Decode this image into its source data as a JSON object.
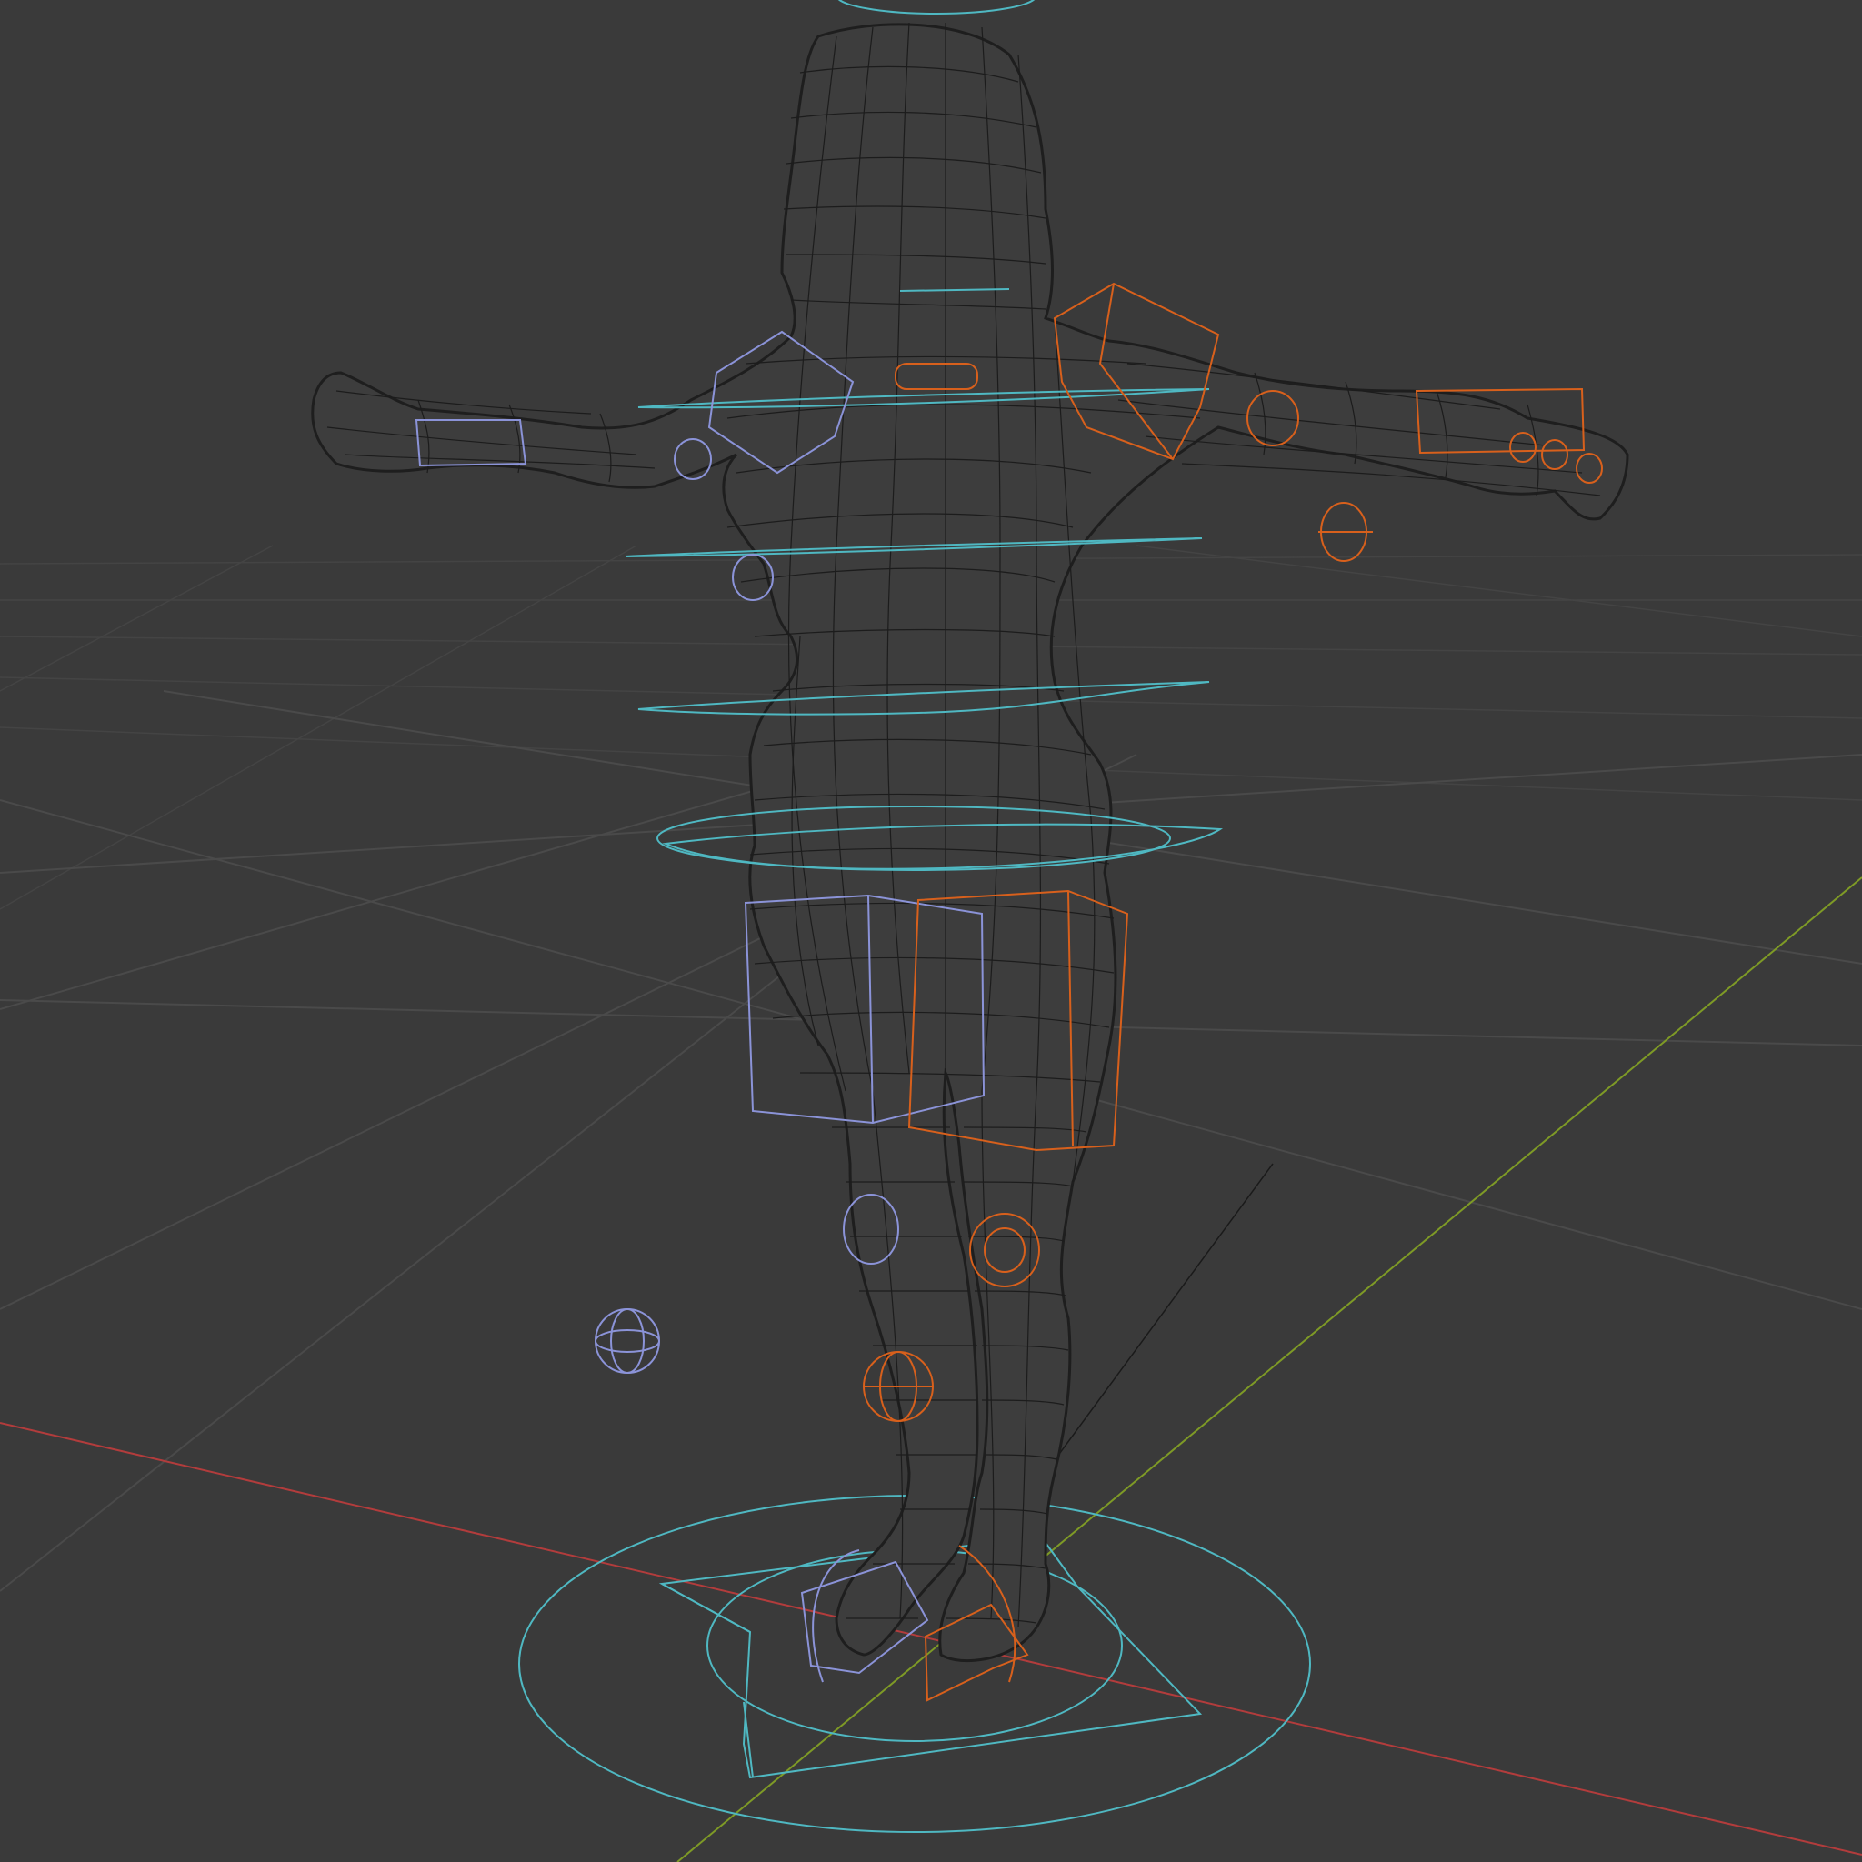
{
  "app": "3D viewport",
  "viewport": {
    "shading": "wireframe",
    "object": "character-mesh",
    "rig": "armature-controls"
  },
  "colors": {
    "background": "#3a3a3a",
    "grid": "#4a4a4a",
    "x_axis": "#b23c3c",
    "y_axis": "#7e9a26",
    "wireframe": "#1c1c1c",
    "control_center": "#4fb8c2",
    "control_left": "#8b93d8",
    "control_right": "#d8601c"
  }
}
